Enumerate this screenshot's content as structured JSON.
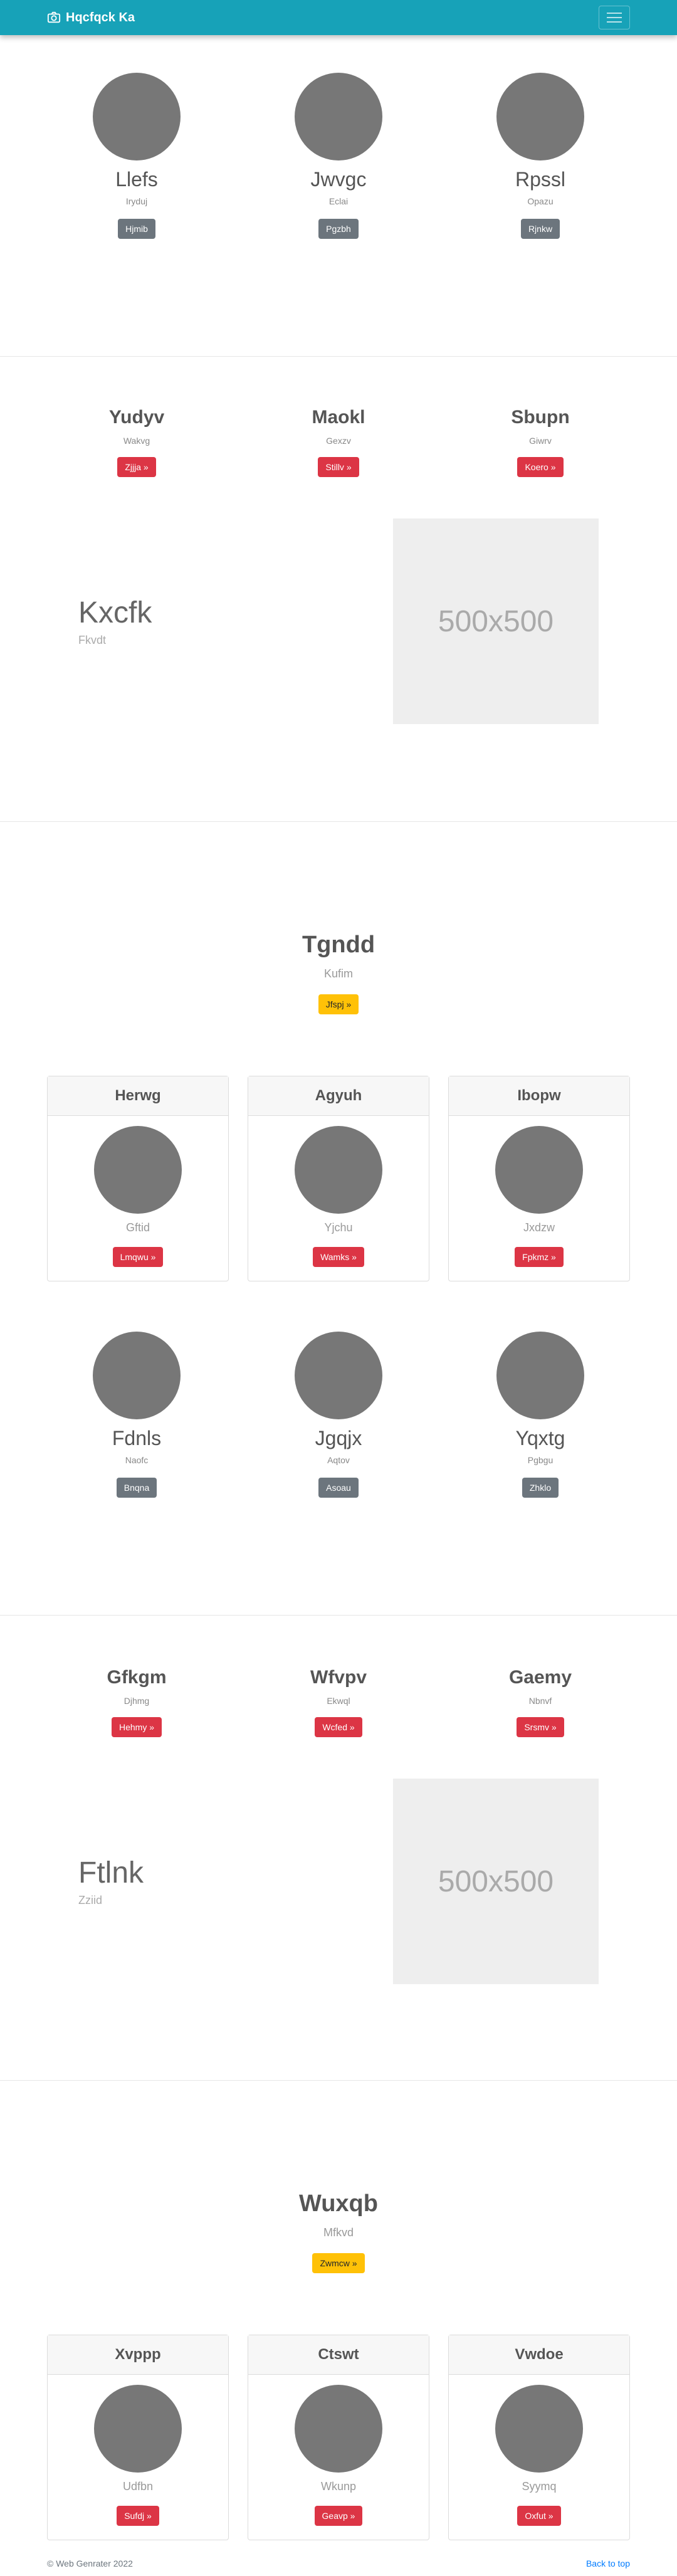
{
  "navbar": {
    "brand": "Hqcfqck Ka"
  },
  "section1": [
    {
      "name": "Llefs",
      "sub": "Iryduj",
      "button": "Hjmib"
    },
    {
      "name": "Jwvgc",
      "sub": "Eclai",
      "button": "Pgzbh"
    },
    {
      "name": "Rpssl",
      "sub": "Opazu",
      "button": "Rjnkw"
    }
  ],
  "section2": {
    "columns": [
      {
        "title": "Yudyv",
        "sub": "Wakvg",
        "button": "Zjjja »"
      },
      {
        "title": "Maokl",
        "sub": "Gexzv",
        "button": "Stillv »"
      },
      {
        "title": "Sbupn",
        "sub": "Giwrv",
        "button": "Koero »"
      }
    ],
    "feature": {
      "title": "Kxcfk",
      "sub": "Fkvdt",
      "image": "500x500"
    }
  },
  "section3": {
    "hero": {
      "title": "Tgndd",
      "sub": "Kufim",
      "button": "Jfspj »"
    },
    "cards": [
      {
        "header": "Herwg",
        "sub": "Gftid",
        "button": "Lmqwu »"
      },
      {
        "header": "Agyuh",
        "sub": "Yjchu",
        "button": "Wamks »"
      },
      {
        "header": "Ibopw",
        "sub": "Jxdzw",
        "button": "Fpkmz »"
      }
    ],
    "people": [
      {
        "name": "Fdnls",
        "sub": "Naofc",
        "button": "Bnqna"
      },
      {
        "name": "Jgqjx",
        "sub": "Aqtov",
        "button": "Asoau"
      },
      {
        "name": "Yqxtg",
        "sub": "Pgbgu",
        "button": "Zhklo"
      }
    ]
  },
  "section4": {
    "columns": [
      {
        "title": "Gfkgm",
        "sub": "Djhmg",
        "button": "Hehmy »"
      },
      {
        "title": "Wfvpv",
        "sub": "Ekwql",
        "button": "Wcfed »"
      },
      {
        "title": "Gaemy",
        "sub": "Nbnvf",
        "button": "Srsmv »"
      }
    ],
    "feature": {
      "title": "Ftlnk",
      "sub": "Zziid",
      "image": "500x500"
    }
  },
  "section5": {
    "hero": {
      "title": "Wuxqb",
      "sub": "Mfkvd",
      "button": "Zwmcw »"
    },
    "cards": [
      {
        "header": "Xvppp",
        "sub": "Udfbn",
        "button": "Sufdj »"
      },
      {
        "header": "Ctswt",
        "sub": "Wkunp",
        "button": "Geavp »"
      },
      {
        "header": "Vwdoe",
        "sub": "Syymq",
        "button": "Oxfut »"
      }
    ]
  },
  "footer": {
    "copyright": "© Web Genrater 2022",
    "back_to_top": "Back to top"
  },
  "colors": {
    "navbar": "#17a2b8",
    "danger": "#dc3545",
    "warning": "#ffc107",
    "secondary": "#6c757d",
    "avatar": "#777777"
  }
}
